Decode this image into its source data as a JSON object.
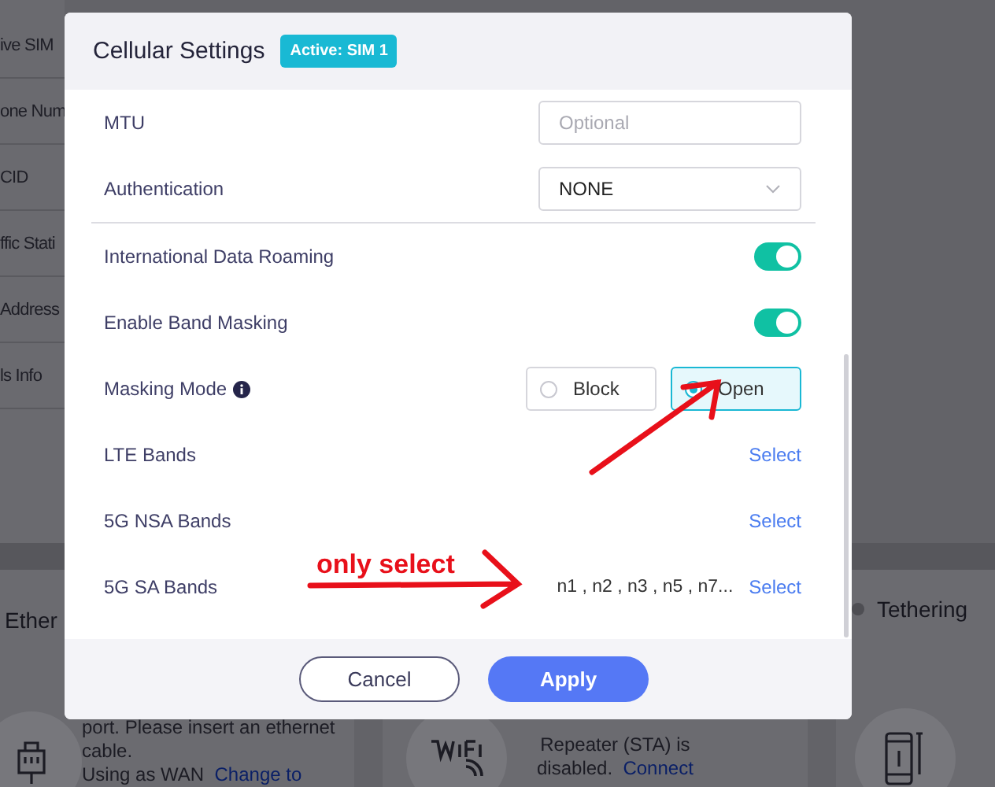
{
  "background": {
    "sidebar_rows": [
      "ive SIM",
      "one Num",
      "CID",
      "ffic Stati",
      "Address",
      "ls Info"
    ],
    "cards": [
      {
        "kind": "ethernet",
        "title": "Ether",
        "lines": [
          "port. Please insert an ethernet",
          "cable."
        ],
        "note": "Using as WAN",
        "link": "Change to"
      },
      {
        "kind": "wifi",
        "lines": [
          "Repeater (STA) is",
          "disabled."
        ],
        "link": "Connect"
      },
      {
        "kind": "tethering",
        "title": "Tethering"
      }
    ]
  },
  "dialog": {
    "title": "Cellular Settings",
    "badge": "Active: SIM 1",
    "sections": [
      [
        {
          "kind": "input",
          "label": "MTU",
          "placeholder": "Optional"
        },
        {
          "kind": "select",
          "label": "Authentication",
          "value": "NONE"
        }
      ],
      [
        {
          "kind": "toggle",
          "label": "International Data Roaming",
          "on": true
        },
        {
          "kind": "toggle",
          "label": "Enable Band Masking",
          "on": true
        },
        {
          "kind": "radio",
          "label": "Masking Mode",
          "info": true,
          "options": [
            {
              "label": "Block",
              "selected": false
            },
            {
              "label": "Open",
              "selected": true
            }
          ]
        },
        {
          "kind": "bands",
          "label": "LTE Bands",
          "link": "Select"
        },
        {
          "kind": "bands",
          "label": "5G NSA Bands",
          "link": "Select"
        },
        {
          "kind": "bands",
          "label": "5G SA Bands",
          "value": "n1 , n2 , n3 , n5 , n7...",
          "link": "Select"
        }
      ]
    ],
    "buttons": [
      {
        "kind": "secondary",
        "label": "Cancel"
      },
      {
        "kind": "primary",
        "label": "Apply"
      }
    ]
  },
  "annotation": {
    "text": "only select"
  }
}
